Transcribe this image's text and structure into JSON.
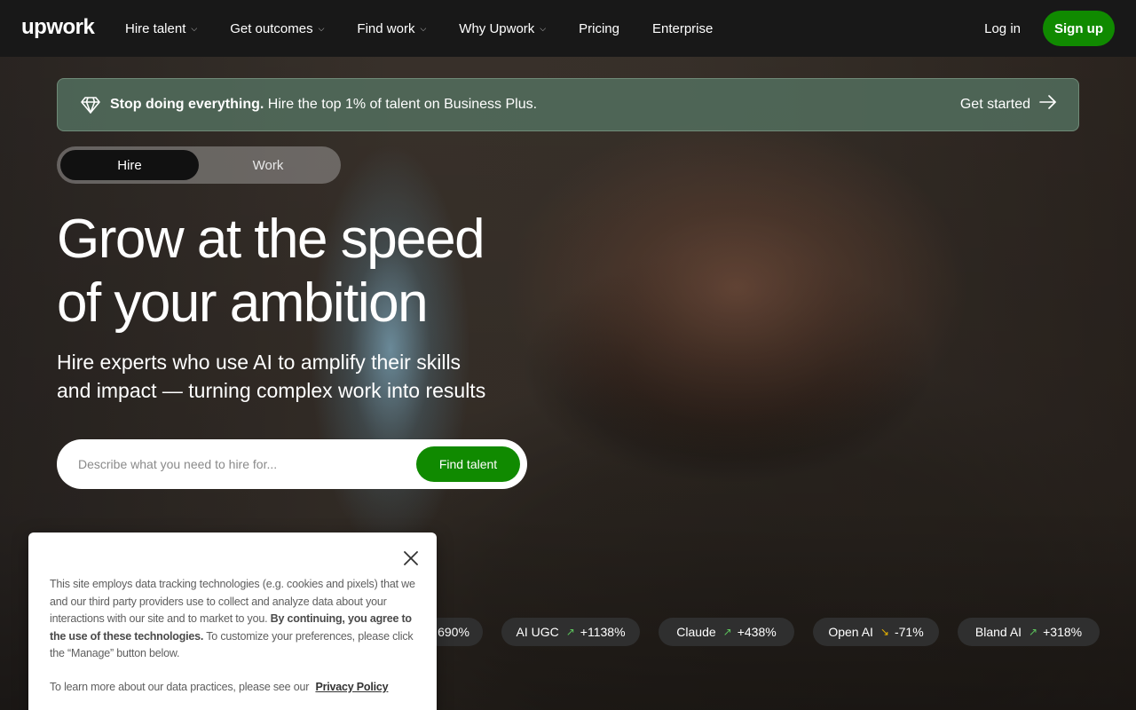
{
  "nav": {
    "logo": "upwork",
    "items": [
      {
        "label": "Hire talent",
        "has_dropdown": true
      },
      {
        "label": "Get outcomes",
        "has_dropdown": true
      },
      {
        "label": "Find work",
        "has_dropdown": true
      },
      {
        "label": "Why Upwork",
        "has_dropdown": true
      },
      {
        "label": "Pricing",
        "has_dropdown": false
      },
      {
        "label": "Enterprise",
        "has_dropdown": false
      }
    ],
    "login": "Log in",
    "signup": "Sign up"
  },
  "promo": {
    "bold": "Stop doing everything.",
    "text": " Hire the top 1% of talent on Business Plus.",
    "cta": "Get started",
    "icon": "diamond-icon"
  },
  "toggle": {
    "hire": "Hire",
    "work": "Work",
    "active": "Hire"
  },
  "hero": {
    "title_line1": "Grow at the speed",
    "title_line2": "of your ambition",
    "subtitle_line1": "Hire experts who use AI to amplify their skills",
    "subtitle_line2": "and impact — turning complex work into results"
  },
  "search": {
    "placeholder": "Describe what you need to hire for...",
    "value": "",
    "button": "Find talent"
  },
  "trends": [
    {
      "name": "",
      "change": "690%",
      "direction": "up"
    },
    {
      "name": "AI UGC",
      "change": "+1138%",
      "direction": "up"
    },
    {
      "name": "Claude",
      "change": "+438%",
      "direction": "up"
    },
    {
      "name": "Open AI",
      "change": "-71%",
      "direction": "down"
    },
    {
      "name": "Bland AI",
      "change": "+318%",
      "direction": "up"
    }
  ],
  "cookie": {
    "text_before_bold": "This site employs data tracking technologies (e.g. cookies and pixels) that we and our third party providers use to collect and analyze data about your interactions with our site and to market to you. ",
    "text_bold": "By continuing, you agree to the use of these technologies.",
    "text_after_bold": " To customize your preferences, please click the “Manage” button below.",
    "privacy_text": "To learn more about our data practices, please see our",
    "privacy_link": "Privacy Policy"
  },
  "colors": {
    "brand_green": "#108a00",
    "navbar_bg": "#181818",
    "promo_bg": "#547260",
    "chip_bg": "#2f2f2f",
    "trend_up": "#5cc35c",
    "trend_down": "#e8b400"
  }
}
